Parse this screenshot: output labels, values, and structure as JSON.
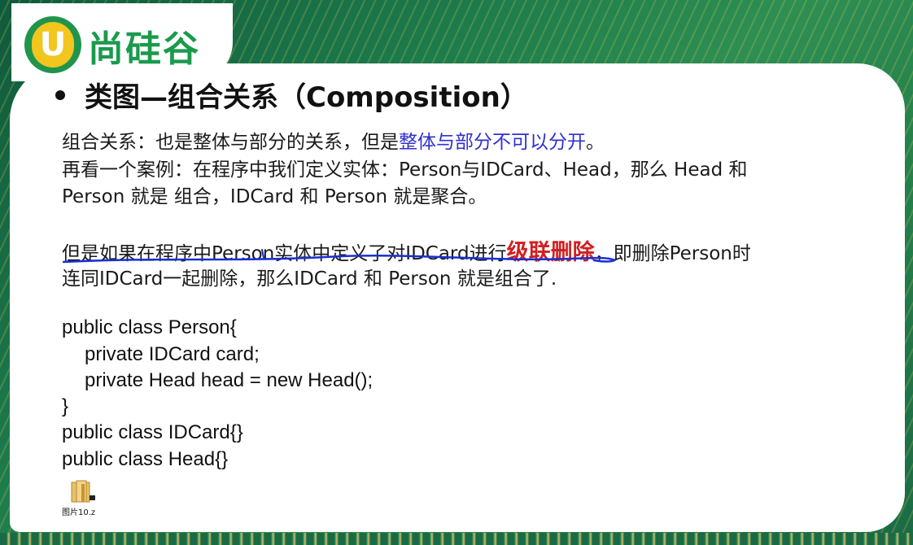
{
  "logo": {
    "mark": "U",
    "text": "尚硅谷"
  },
  "title": "类图—组合关系（Composition）",
  "paragraph1": {
    "line1_a": "组合关系：也是整体与部分的关系，但是",
    "line1_b": "整体与部分不可以分开",
    "line1_c": "。",
    "line2": "再看一个案例：在程序中我们定义实体：Person与IDCard、Head，那么 Head 和",
    "line3": "Person 就是 组合，IDCard 和 Person 就是聚合。"
  },
  "paragraph2": {
    "line1_a": "但是如果在程序中Person实体中定义了对IDCard进行",
    "line1_b": "级联删除",
    "line1_c": "，即删除Person时",
    "line2": "连同IDCard一起删除，那么IDCard 和 Person 就是组合了."
  },
  "code": [
    "public class Person{",
    "    private IDCard card;",
    "    private Head head = new Head();",
    "}",
    "public class IDCard{}",
    "public class Head{}"
  ],
  "file": {
    "label": "图片10.z",
    "icon": "folder-file-icon"
  },
  "colors": {
    "highlight_blue": "#3030d0",
    "highlight_red": "#d11f1f",
    "brand_green": "#21944c",
    "brand_yellow": "#f3c51f",
    "annotation_stroke": "#1a2fd0"
  }
}
